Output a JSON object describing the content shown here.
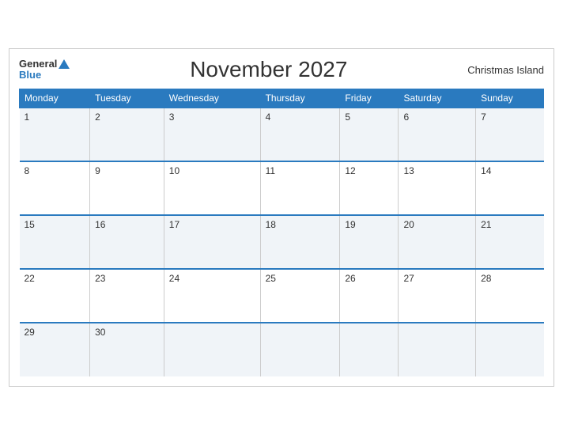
{
  "header": {
    "logo_general": "General",
    "logo_blue": "Blue",
    "title": "November 2027",
    "region": "Christmas Island"
  },
  "weekdays": [
    "Monday",
    "Tuesday",
    "Wednesday",
    "Thursday",
    "Friday",
    "Saturday",
    "Sunday"
  ],
  "weeks": [
    [
      "1",
      "2",
      "3",
      "4",
      "5",
      "6",
      "7"
    ],
    [
      "8",
      "9",
      "10",
      "11",
      "12",
      "13",
      "14"
    ],
    [
      "15",
      "16",
      "17",
      "18",
      "19",
      "20",
      "21"
    ],
    [
      "22",
      "23",
      "24",
      "25",
      "26",
      "27",
      "28"
    ],
    [
      "29",
      "30",
      "",
      "",
      "",
      "",
      ""
    ]
  ]
}
